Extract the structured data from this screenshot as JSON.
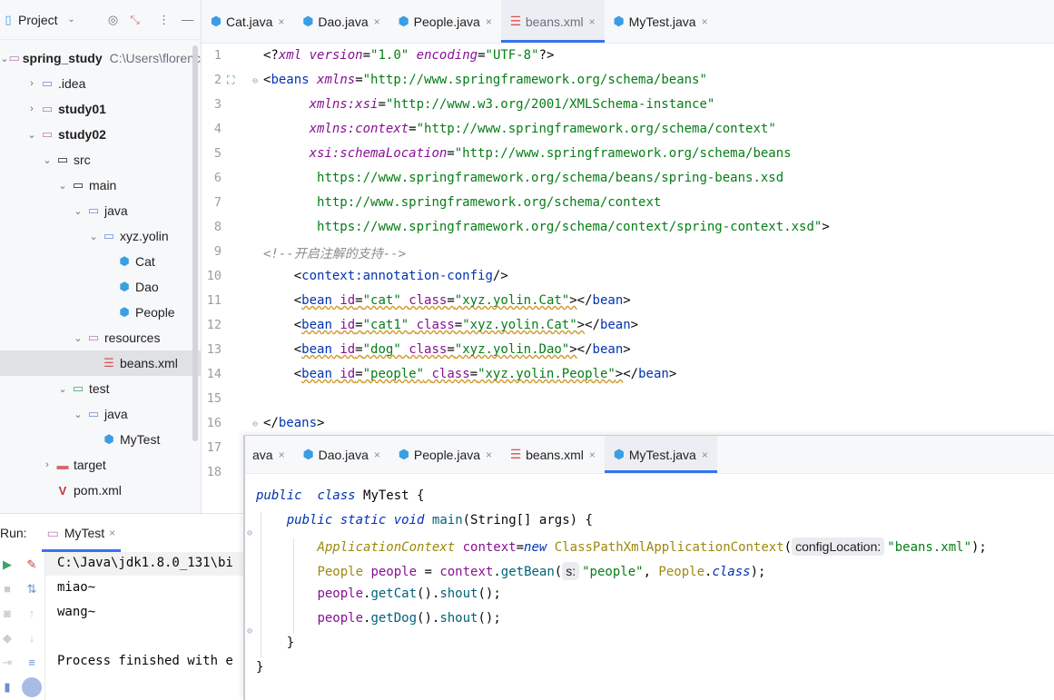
{
  "project_panel": {
    "title": "Project",
    "tree": [
      {
        "label": "spring_study",
        "extra": "C:\\Users\\florenc",
        "indent": 0,
        "chev": "v",
        "icon": "folder",
        "bold": true
      },
      {
        "label": ".idea",
        "indent": 1,
        "chev": ">",
        "icon": "folder-idea",
        "bold": false
      },
      {
        "label": "study01",
        "indent": 1,
        "chev": ">",
        "icon": "folder-module",
        "bold": true
      },
      {
        "label": "study02",
        "indent": 1,
        "chev": "v",
        "icon": "folder-module",
        "bold": true
      },
      {
        "label": "src",
        "indent": 2,
        "chev": "v",
        "icon": "folder-plain",
        "bold": false
      },
      {
        "label": "main",
        "indent": 3,
        "chev": "v",
        "icon": "folder-plain",
        "bold": false
      },
      {
        "label": "java",
        "indent": 4,
        "chev": "v",
        "icon": "folder-src",
        "bold": false
      },
      {
        "label": "xyz.yolin",
        "indent": 5,
        "chev": "v",
        "icon": "package",
        "bold": false
      },
      {
        "label": "Cat",
        "indent": 6,
        "chev": "",
        "icon": "class",
        "bold": false
      },
      {
        "label": "Dao",
        "indent": 6,
        "chev": "",
        "icon": "class",
        "bold": false
      },
      {
        "label": "People",
        "indent": 6,
        "chev": "",
        "icon": "class",
        "bold": false
      },
      {
        "label": "resources",
        "indent": 4,
        "chev": "v",
        "icon": "folder-res",
        "bold": false
      },
      {
        "label": "beans.xml",
        "indent": 5,
        "chev": "",
        "icon": "xml",
        "bold": false,
        "selected": true
      },
      {
        "label": "test",
        "indent": 3,
        "chev": "v",
        "icon": "folder-test",
        "bold": false
      },
      {
        "label": "java",
        "indent": 4,
        "chev": "v",
        "icon": "folder-src",
        "bold": false
      },
      {
        "label": "MyTest",
        "indent": 5,
        "chev": "",
        "icon": "class-test",
        "bold": false
      },
      {
        "label": "target",
        "indent": 2,
        "chev": ">",
        "icon": "folder-target",
        "bold": false
      },
      {
        "label": "pom.xml",
        "indent": 2,
        "chev": "",
        "icon": "maven",
        "bold": false
      }
    ]
  },
  "top_tabs": [
    {
      "label": "Cat.java",
      "icon": "class",
      "active": false
    },
    {
      "label": "Dao.java",
      "icon": "class",
      "active": false
    },
    {
      "label": "People.java",
      "icon": "class",
      "active": false
    },
    {
      "label": "beans.xml",
      "icon": "xml",
      "active": true
    },
    {
      "label": "MyTest.java",
      "icon": "class-test",
      "active": false
    }
  ],
  "xml_editor": {
    "line_numbers": [
      "1",
      "2",
      "3",
      "4",
      "5",
      "6",
      "7",
      "8",
      "9",
      "10",
      "11",
      "12",
      "13",
      "14",
      "15",
      "16",
      "17",
      "18"
    ],
    "lines": [
      [
        [
          "x-plain",
          "<?"
        ],
        [
          "x-attr",
          "xml"
        ],
        [
          "x-plain",
          " "
        ],
        [
          "x-attr",
          "version"
        ],
        [
          "x-plain",
          "="
        ],
        [
          "x-str",
          "\"1.0\""
        ],
        [
          "x-plain",
          " "
        ],
        [
          "x-attr",
          "encoding"
        ],
        [
          "x-plain",
          "="
        ],
        [
          "x-str",
          "\"UTF-8\""
        ],
        [
          "x-plain",
          "?>"
        ]
      ],
      [
        [
          "x-plain",
          "<"
        ],
        [
          "x-tag",
          "beans"
        ],
        [
          "x-plain",
          " "
        ],
        [
          "x-attr",
          "xmlns"
        ],
        [
          "x-plain",
          "="
        ],
        [
          "x-str",
          "\"http://www.springframework.org/schema/beans\""
        ]
      ],
      [
        [
          "x-plain",
          "      "
        ],
        [
          "x-attr",
          "xmlns:xsi"
        ],
        [
          "x-plain",
          "="
        ],
        [
          "x-str",
          "\"http://www.w3.org/2001/XMLSchema-instance\""
        ]
      ],
      [
        [
          "x-plain",
          "      "
        ],
        [
          "x-attr",
          "xmlns:context"
        ],
        [
          "x-plain",
          "="
        ],
        [
          "x-str",
          "\"http://www.springframework.org/schema/context\""
        ]
      ],
      [
        [
          "x-plain",
          "      "
        ],
        [
          "x-attr",
          "xsi:schemaLocation"
        ],
        [
          "x-plain",
          "="
        ],
        [
          "x-str",
          "\"http://www.springframework.org/schema/beans"
        ]
      ],
      [
        [
          "x-plain",
          "       "
        ],
        [
          "x-str",
          "https://www.springframework.org/schema/beans/spring-beans.xsd"
        ]
      ],
      [
        [
          "x-plain",
          "       "
        ],
        [
          "x-str",
          "http://www.springframework.org/schema/context"
        ]
      ],
      [
        [
          "x-plain",
          "       "
        ],
        [
          "x-str",
          "https://www.springframework.org/schema/context/spring-context.xsd\""
        ],
        [
          "x-plain",
          ">"
        ]
      ],
      [
        [
          "x-cmt",
          "<!--开启注解的支持-->"
        ]
      ],
      [
        [
          "x-plain",
          "    <"
        ],
        [
          "x-tag",
          "context:annotation-config"
        ],
        [
          "x-plain",
          "/>"
        ]
      ],
      [
        [
          "x-plain",
          "    <"
        ],
        [
          "x-tag squig",
          "bean"
        ],
        [
          "x-plain squig",
          " "
        ],
        [
          "x-attr2 squig",
          "id"
        ],
        [
          "x-plain squig",
          "="
        ],
        [
          "x-str squig",
          "\"cat\""
        ],
        [
          "x-plain squig",
          " "
        ],
        [
          "x-attr2 squig",
          "class"
        ],
        [
          "x-plain squig",
          "="
        ],
        [
          "x-str squig",
          "\"xyz.yolin.Cat\""
        ],
        [
          "x-plain squig",
          ">"
        ],
        [
          "x-plain",
          "</"
        ],
        [
          "x-tag",
          "bean"
        ],
        [
          "x-plain",
          ">"
        ]
      ],
      [
        [
          "x-plain",
          "    <"
        ],
        [
          "x-tag squig",
          "bean"
        ],
        [
          "x-plain squig",
          " "
        ],
        [
          "x-attr2 squig",
          "id"
        ],
        [
          "x-plain squig",
          "="
        ],
        [
          "x-str squig",
          "\"cat1\""
        ],
        [
          "x-plain squig",
          " "
        ],
        [
          "x-attr2 squig",
          "class"
        ],
        [
          "x-plain squig",
          "="
        ],
        [
          "x-str squig",
          "\"xyz.yolin.Cat\""
        ],
        [
          "x-plain squig",
          ">"
        ],
        [
          "x-plain",
          "</"
        ],
        [
          "x-tag",
          "bean"
        ],
        [
          "x-plain",
          ">"
        ]
      ],
      [
        [
          "x-plain",
          "    <"
        ],
        [
          "x-tag squig",
          "bean"
        ],
        [
          "x-plain squig",
          " "
        ],
        [
          "x-attr2 squig",
          "id"
        ],
        [
          "x-plain squig",
          "="
        ],
        [
          "x-str squig",
          "\"dog\""
        ],
        [
          "x-plain squig",
          " "
        ],
        [
          "x-attr2 squig",
          "class"
        ],
        [
          "x-plain squig",
          "="
        ],
        [
          "x-str squig",
          "\"xyz.yolin.Dao\""
        ],
        [
          "x-plain squig",
          ">"
        ],
        [
          "x-plain",
          "</"
        ],
        [
          "x-tag",
          "bean"
        ],
        [
          "x-plain",
          ">"
        ]
      ],
      [
        [
          "x-plain",
          "    <"
        ],
        [
          "x-tag squig",
          "bean"
        ],
        [
          "x-plain squig",
          " "
        ],
        [
          "x-attr2 squig",
          "id"
        ],
        [
          "x-plain squig",
          "="
        ],
        [
          "x-str squig",
          "\"people\""
        ],
        [
          "x-plain squig",
          " "
        ],
        [
          "x-attr2 squig",
          "class"
        ],
        [
          "x-plain squig",
          "="
        ],
        [
          "x-str squig",
          "\"xyz.yolin.People\""
        ],
        [
          "x-plain squig",
          ">"
        ],
        [
          "x-plain",
          "</"
        ],
        [
          "x-tag",
          "bean"
        ],
        [
          "x-plain",
          ">"
        ]
      ],
      [],
      [
        [
          "x-plain",
          "</"
        ],
        [
          "x-tag",
          "beans"
        ],
        [
          "x-plain",
          ">"
        ]
      ],
      [],
      []
    ]
  },
  "run_panel": {
    "label": "Run:",
    "tab_label": "MyTest",
    "output": [
      "C:\\Java\\jdk1.8.0_131\\bi",
      "miao~",
      "wang~",
      "",
      "Process finished with e"
    ]
  },
  "bottom_tabs": [
    {
      "label": "ava",
      "icon": "",
      "active": false
    },
    {
      "label": "Dao.java",
      "icon": "class",
      "active": false
    },
    {
      "label": "People.java",
      "icon": "class",
      "active": false
    },
    {
      "label": "beans.xml",
      "icon": "xml",
      "active": false
    },
    {
      "label": "MyTest.java",
      "icon": "class-test",
      "active": true
    }
  ],
  "java_editor": {
    "lines": [
      [],
      [
        [
          "j-kw",
          "public"
        ],
        [
          "",
          "  "
        ],
        [
          "j-kw",
          "class"
        ],
        [
          "",
          " MyTest {"
        ]
      ],
      [
        [
          "",
          "    "
        ],
        [
          "j-kw",
          "public"
        ],
        [
          "",
          " "
        ],
        [
          "j-kw",
          "static"
        ],
        [
          "",
          " "
        ],
        [
          "j-kw",
          "void"
        ],
        [
          "",
          " "
        ],
        [
          "j-mth",
          "main"
        ],
        [
          "",
          "(String[] args) {"
        ]
      ],
      [
        [
          "",
          "        "
        ],
        [
          "j-type j-ital",
          "ApplicationContext"
        ],
        [
          "",
          " "
        ],
        [
          "j-var",
          "context"
        ],
        [
          "",
          "="
        ],
        [
          "j-kw",
          "new"
        ],
        [
          "",
          " "
        ],
        [
          "j-type",
          "ClassPathXmlApplicationContext"
        ],
        [
          "",
          "("
        ],
        [
          "hint",
          "configLocation:"
        ],
        [
          "j-str",
          "\"beans.xml\""
        ],
        [
          "",
          ");"
        ]
      ],
      [
        [
          "",
          "        "
        ],
        [
          "j-type",
          "People"
        ],
        [
          "",
          " "
        ],
        [
          "j-var",
          "people"
        ],
        [
          "",
          " = "
        ],
        [
          "j-var",
          "context"
        ],
        [
          "",
          "."
        ],
        [
          "j-mth",
          "getBean"
        ],
        [
          "",
          "("
        ],
        [
          "hint",
          "s:"
        ],
        [
          "j-str",
          "\"people\""
        ],
        [
          "",
          ", "
        ],
        [
          "j-type",
          "People"
        ],
        [
          "",
          "."
        ],
        [
          "j-kw",
          "class"
        ],
        [
          "",
          ");"
        ]
      ],
      [
        [
          "",
          "        "
        ],
        [
          "j-var",
          "people"
        ],
        [
          "",
          "."
        ],
        [
          "j-mth",
          "getCat"
        ],
        [
          "",
          "()."
        ],
        [
          "j-mth",
          "shout"
        ],
        [
          "",
          "();"
        ]
      ],
      [
        [
          "",
          "        "
        ],
        [
          "j-var",
          "people"
        ],
        [
          "",
          "."
        ],
        [
          "j-mth",
          "getDog"
        ],
        [
          "",
          "()."
        ],
        [
          "j-mth",
          "shout"
        ],
        [
          "",
          "();"
        ]
      ],
      [
        [
          "",
          "    }"
        ]
      ],
      [
        [
          "",
          "}"
        ]
      ]
    ]
  },
  "colors": {
    "accent": "#3574f0",
    "selection": "#dfe1e5",
    "panel": "#f7f8fa"
  }
}
